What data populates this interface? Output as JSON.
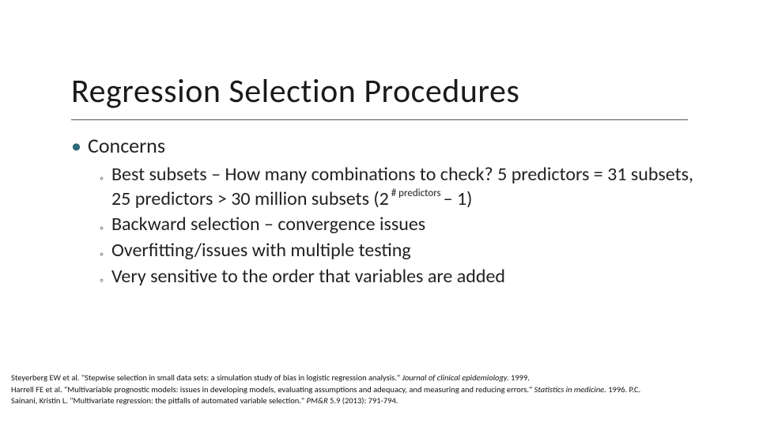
{
  "title": "Regression Selection Procedures",
  "lvl1": {
    "bullet": "•",
    "text": "Concerns"
  },
  "sub_bullet": "◦",
  "subs": {
    "a_pre": "Best subsets – How many combinations to check? 5 predictors = 31 subsets, 25 predictors > 30 million subsets (2",
    "a_sup": " # predictors ",
    "a_post": "– 1)",
    "b": "Backward selection – convergence issues",
    "c": "Overfitting/issues with multiple testing",
    "d": "Very sensitive to the order that variables are added"
  },
  "refs": {
    "r1a": "Steyerberg EW et al. \"Stepwise selection in small data sets: a simulation study of bias in logistic regression analysis.\" ",
    "r1i": "Journal of clinical epidemiology.",
    "r1b": " 1999.",
    "r2a": "Harrell FE et al. \"Multivariable prognostic models: issues in developing models, evaluating assumptions and adequacy, and measuring and reducing errors.\" ",
    "r2i": "Statistics in medicine.",
    "r2b": " 1996. P.C.",
    "r3a": "Sainani, Kristin L. \"Multivariate regression: the pitfalls of automated variable selection.\" ",
    "r3i": "PM&R",
    "r3b": " 5.9 (2013): 791-794."
  }
}
